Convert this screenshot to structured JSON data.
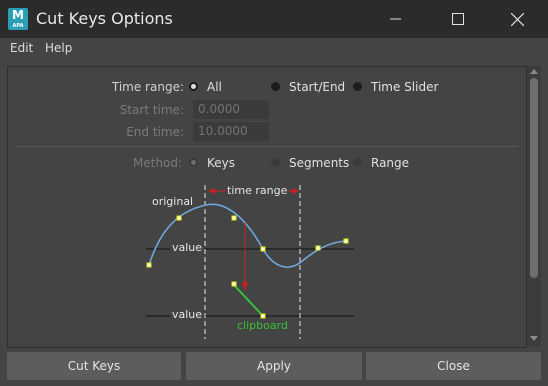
{
  "window": {
    "title": "Cut Keys Options",
    "app_icon_letter": "M",
    "app_icon_sub": "APA"
  },
  "menu": {
    "items": [
      "Edit",
      "Help"
    ]
  },
  "form": {
    "time_range": {
      "label": "Time range:",
      "options": [
        "All",
        "Start/End",
        "Time Slider"
      ],
      "selected": "All"
    },
    "start_time": {
      "label": "Start time:",
      "value": "0.0000"
    },
    "end_time": {
      "label": "End time:",
      "value": "10.0000"
    },
    "method": {
      "label": "Method:",
      "options": [
        "Keys",
        "Segments",
        "Range"
      ],
      "selected": "Keys"
    }
  },
  "diagram": {
    "label_original": "original",
    "label_time_range": "time range",
    "label_value_top": "value",
    "label_value_bottom": "value",
    "label_clipboard": "clipboard"
  },
  "buttons": {
    "cut_keys": "Cut Keys",
    "apply": "Apply",
    "close": "Close"
  },
  "colors": {
    "curve": "#6fa8dc",
    "key": "#e0e800",
    "arrow": "#cc2020",
    "clipboard": "#39c039"
  }
}
